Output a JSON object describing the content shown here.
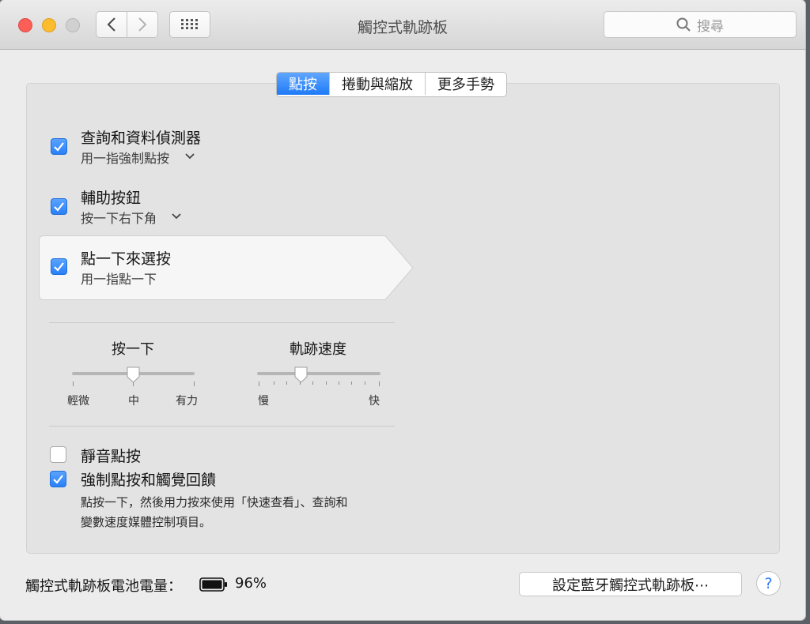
{
  "window": {
    "title": "觸控式軌跡板",
    "search_placeholder": "搜尋"
  },
  "tabs": [
    {
      "label": "點按",
      "active": true
    },
    {
      "label": "捲動與縮放",
      "active": false
    },
    {
      "label": "更多手勢",
      "active": false
    }
  ],
  "options": [
    {
      "title": "查詢和資料偵測器",
      "subtitle": "用一指強制點按",
      "checked": true,
      "has_dropdown": true
    },
    {
      "title": "輔助按鈕",
      "subtitle": "按一下右下角",
      "checked": true,
      "has_dropdown": true
    },
    {
      "title": "點一下來選按",
      "subtitle": "用一指點一下",
      "checked": true,
      "selected": true
    }
  ],
  "sliders": {
    "click": {
      "title": "按一下",
      "min_label": "輕微",
      "mid_label": "中",
      "max_label": "有力",
      "value": 0.5
    },
    "tracking": {
      "title": "軌跡速度",
      "min_label": "慢",
      "max_label": "快",
      "value": 0.35
    }
  },
  "bottom_options": [
    {
      "title": "靜音點按",
      "checked": false
    },
    {
      "title": "強制點按和觸覺回饋",
      "checked": true,
      "description_line1": "點按一下，然後用力按來使用「快速查看」、查詢和",
      "description_line2": "變數速度媒體控制項目。"
    }
  ],
  "footer": {
    "battery_label": "觸控式軌跡板電池電量：",
    "battery_percent": "96%",
    "bt_button_label": "設定藍牙觸控式軌跡板⋯",
    "help_label": "?"
  },
  "colors": {
    "accent": "#2a80f8",
    "panel": "#e3e3e3",
    "window": "#ececec"
  }
}
